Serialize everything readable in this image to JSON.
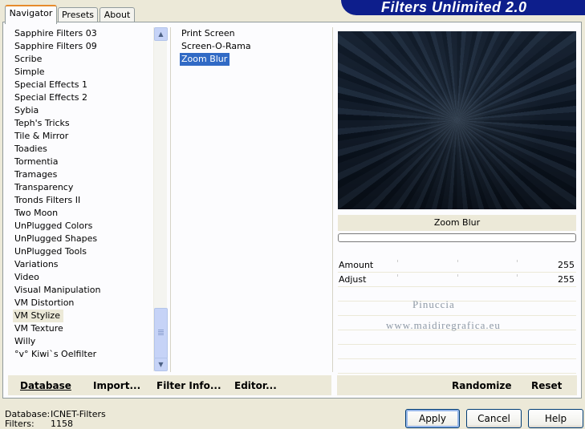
{
  "window": {
    "title": "Filters Unlimited 2.0"
  },
  "tabs": [
    {
      "label": "Navigator",
      "active": true
    },
    {
      "label": "Presets",
      "active": false
    },
    {
      "label": "About",
      "active": false
    }
  ],
  "categories": {
    "items": [
      "Sapphire Filters 03",
      "Sapphire Filters 09",
      "Scribe",
      "Simple",
      "Special Effects 1",
      "Special Effects 2",
      "Sybia",
      "Teph's Tricks",
      "Tile & Mirror",
      "Toadies",
      "Tormentia",
      "Tramages",
      "Transparency",
      "Tronds Filters II",
      "Two Moon",
      "UnPlugged Colors",
      "UnPlugged Shapes",
      "UnPlugged Tools",
      "Variations",
      "Video",
      "Visual Manipulation",
      "VM Distortion",
      "VM Stylize",
      "VM Texture",
      "Willy",
      "°v° Kiwi`s Oelfilter"
    ],
    "selected": "VM Stylize"
  },
  "filters": {
    "items": [
      "Print Screen",
      "Screen-O-Rama",
      "Zoom Blur"
    ],
    "selected": "Zoom Blur"
  },
  "preview": {
    "filter_name": "Zoom Blur",
    "progress": 0
  },
  "parameters": [
    {
      "label": "Amount",
      "value": "255"
    },
    {
      "label": "Adjust",
      "value": "255"
    }
  ],
  "watermark": {
    "line1": "Pinuccia",
    "line2": "www.maidiregrafica.eu"
  },
  "left_actions": {
    "database": "Database",
    "import": "Import...",
    "filter_info": "Filter Info...",
    "editor": "Editor..."
  },
  "right_actions": {
    "randomize": "Randomize",
    "reset": "Reset"
  },
  "status": {
    "database_label": "Database:",
    "database_value": "ICNET-Filters",
    "filters_label": "Filters:",
    "filters_value": "1158"
  },
  "buttons": {
    "apply": "Apply",
    "cancel": "Cancel",
    "help": "Help"
  },
  "colors": {
    "banner": "#0d1e8c",
    "selection": "#316ac5",
    "face": "#ece9d8"
  }
}
